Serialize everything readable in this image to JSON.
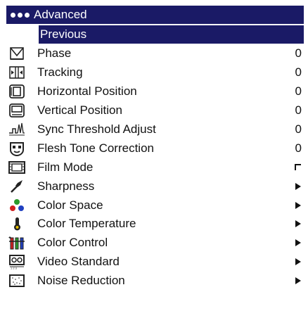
{
  "menu": {
    "title": "Advanced",
    "selected": "Previous",
    "items": [
      {
        "label": "Phase",
        "value": "0",
        "icon": "phase-icon"
      },
      {
        "label": "Tracking",
        "value": "0",
        "icon": "tracking-icon"
      },
      {
        "label": "Horizontal Position",
        "value": "0",
        "icon": "horizontal-position-icon"
      },
      {
        "label": "Vertical Position",
        "value": "0",
        "icon": "vertical-position-icon"
      },
      {
        "label": "Sync Threshold Adjust",
        "value": "0",
        "icon": "sync-threshold-icon"
      },
      {
        "label": "Flesh Tone Correction",
        "value": "0",
        "icon": "flesh-tone-icon"
      },
      {
        "label": "Film Mode",
        "control": "checkbox",
        "checked": false,
        "icon": "film-mode-icon"
      },
      {
        "label": "Sharpness",
        "control": "submenu-arrow",
        "icon": "sharpness-icon"
      },
      {
        "label": "Color Space",
        "control": "submenu-arrow",
        "icon": "color-space-icon"
      },
      {
        "label": "Color Temperature",
        "control": "submenu-arrow",
        "icon": "color-temperature-icon"
      },
      {
        "label": "Color Control",
        "control": "submenu-arrow",
        "icon": "color-control-icon"
      },
      {
        "label": "Video Standard",
        "control": "submenu-arrow",
        "icon": "video-standard-icon"
      },
      {
        "label": "Noise Reduction",
        "control": "submenu-arrow",
        "icon": "noise-reduction-icon"
      }
    ]
  },
  "colors": {
    "highlight": "#1a1a66",
    "text": "#111111",
    "background": "#ffffff"
  }
}
